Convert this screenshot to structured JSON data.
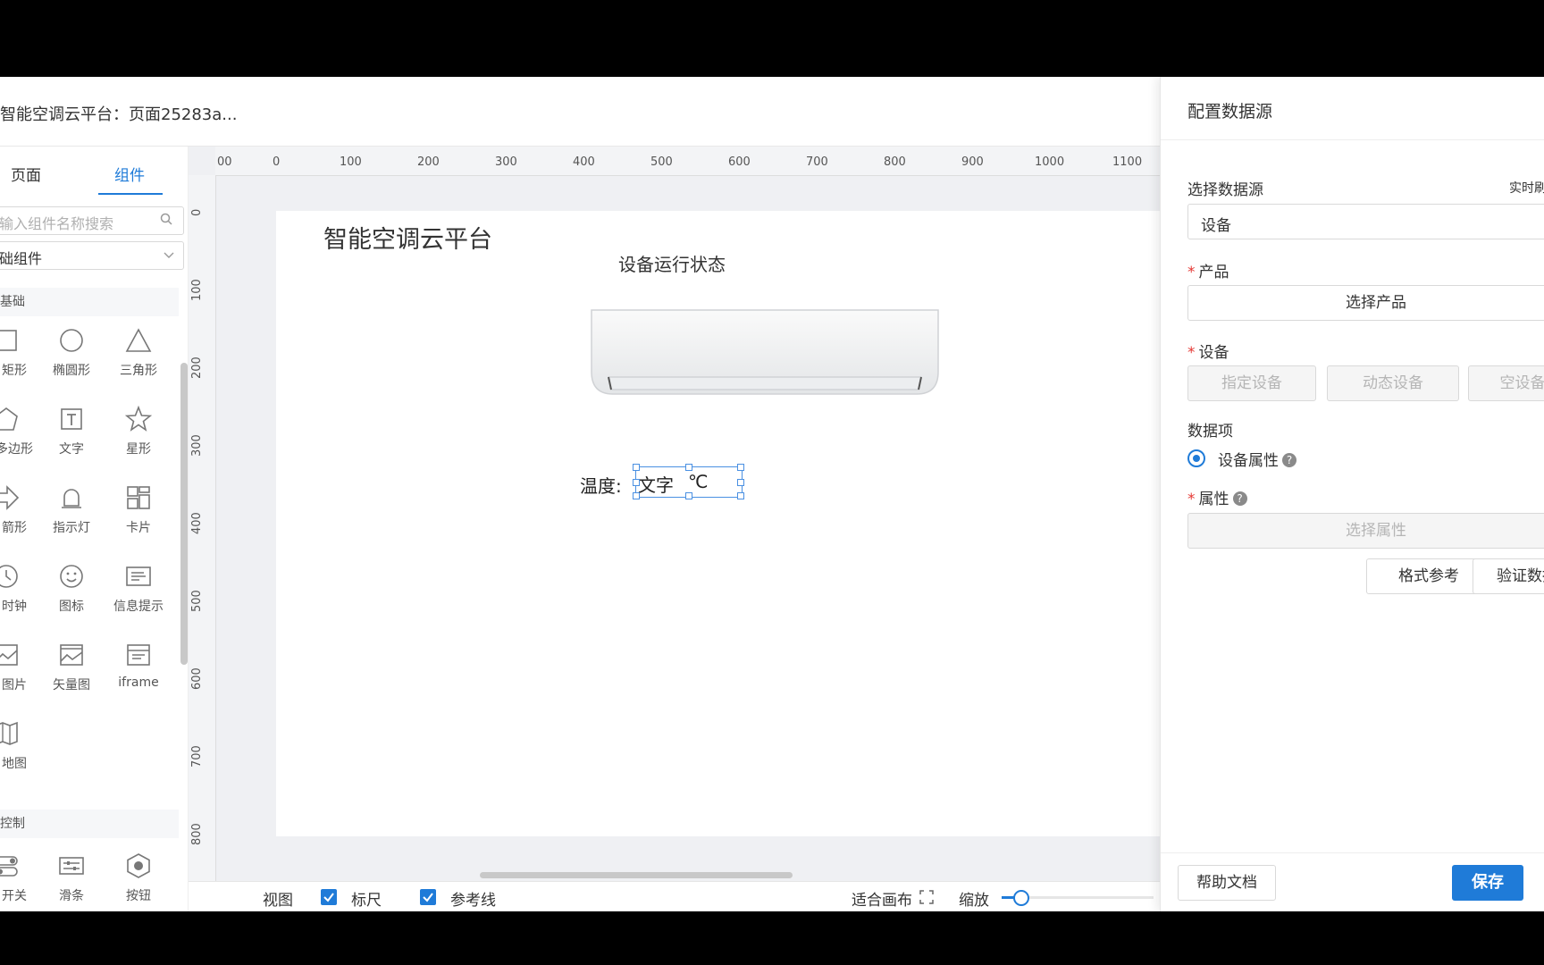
{
  "header": {
    "title": "智能空调云平台：页面25283a..."
  },
  "left_panel": {
    "tabs": [
      "页面",
      "组件"
    ],
    "search_placeholder": "输入组件名称搜索",
    "category_select": "础组件",
    "group_basic": "基础",
    "group_control": "控制",
    "items": {
      "rect": "矩形",
      "ellipse": "椭圆形",
      "triangle": "三角形",
      "polygon": "多边形",
      "text": "文字",
      "star": "星形",
      "arrow": "箭形",
      "indicator": "指示灯",
      "card": "卡片",
      "clock": "时钟",
      "icon": "图标",
      "info": "信息提示",
      "image": "图片",
      "vector": "矢量图",
      "iframe": "iframe",
      "map": "地图",
      "switch": "开关",
      "slider": "滑条",
      "button": "按钮"
    }
  },
  "ruler": {
    "top": [
      "00",
      "0",
      "100",
      "200",
      "300",
      "400",
      "500",
      "600",
      "700",
      "800",
      "900",
      "1000",
      "1100"
    ],
    "left": [
      "0",
      "100",
      "200",
      "300",
      "400",
      "500",
      "600",
      "700",
      "800"
    ]
  },
  "canvas": {
    "title": "智能空调云平台",
    "subtitle": "设备运行状态",
    "temp_label": "温度:",
    "temp_value": "文字",
    "temp_unit": "℃"
  },
  "bottom_bar": {
    "view": "视图",
    "ruler_toggle": "标尺",
    "guides_toggle": "参考线",
    "fit_canvas": "适合画布",
    "zoom": "缩放",
    "zoom_level": 0.13
  },
  "drawer": {
    "title": "配置数据源",
    "select_source_label": "选择数据源",
    "realtime_label": "实时刷",
    "source_value": "设备",
    "product_label": "产品",
    "product_button": "选择产品",
    "device_label": "设备",
    "device_buttons": [
      "指定设备",
      "动态设备",
      "空设备"
    ],
    "data_item_label": "数据项",
    "radio_label": "设备属性",
    "attr_label": "属性",
    "attr_button": "选择属性",
    "format_button": "格式参考",
    "verify_button": "验证数据",
    "help_button": "帮助文档",
    "save_button": "保存"
  },
  "colors": {
    "accent": "#1f7bd8",
    "required": "#e53935"
  }
}
